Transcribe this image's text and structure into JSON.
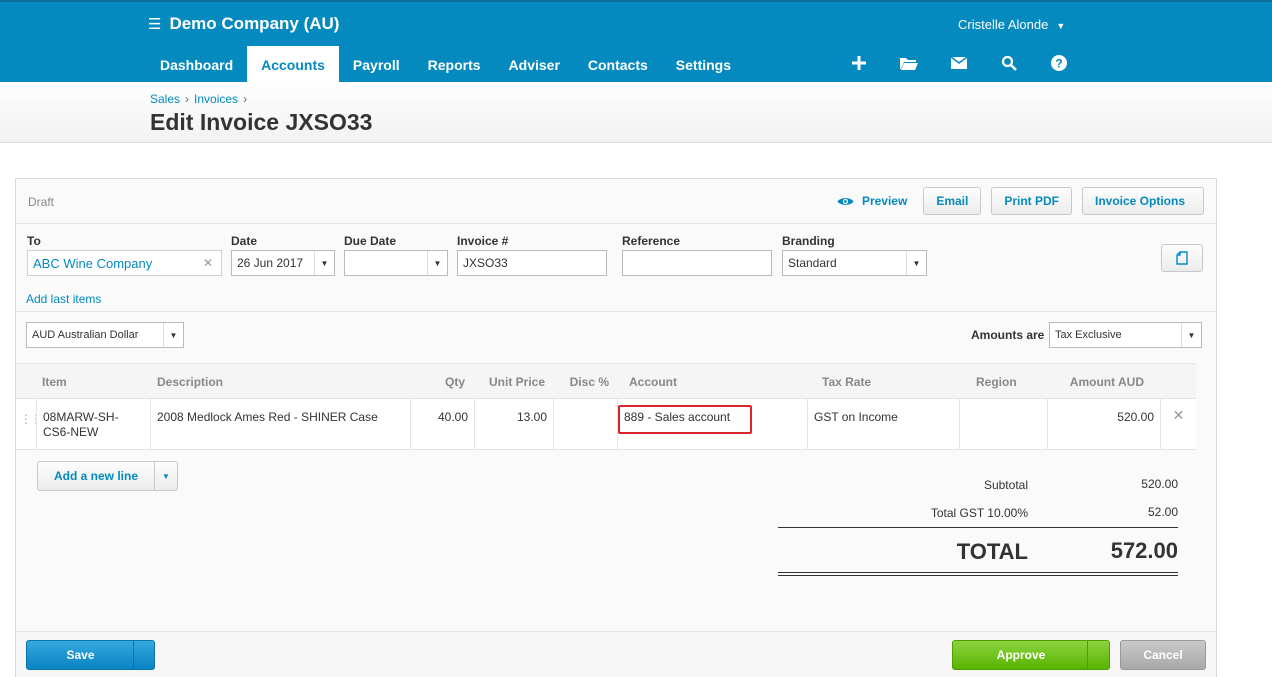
{
  "header": {
    "org_name": "Demo Company (AU)",
    "user_name": "Cristelle Alonde",
    "nav": [
      "Dashboard",
      "Accounts",
      "Payroll",
      "Reports",
      "Adviser",
      "Contacts",
      "Settings"
    ],
    "active_nav": "Accounts",
    "icons": [
      "plus-icon",
      "folder-open-icon",
      "envelope-icon",
      "search-icon",
      "help-icon"
    ]
  },
  "breadcrumb": {
    "sales": "Sales",
    "invoices": "Invoices",
    "sep": "›"
  },
  "page_title": "Edit Invoice JXSO33",
  "status": "Draft",
  "actions": {
    "preview": "Preview",
    "email": "Email",
    "print_pdf": "Print PDF",
    "invoice_options": "Invoice Options"
  },
  "form": {
    "to_label": "To",
    "to_value": "ABC Wine Company",
    "date_label": "Date",
    "date_value": "26 Jun 2017",
    "due_date_label": "Due Date",
    "due_date_value": "",
    "invoice_no_label": "Invoice #",
    "invoice_no_value": "JXSO33",
    "reference_label": "Reference",
    "reference_value": "",
    "branding_label": "Branding",
    "branding_value": "Standard",
    "add_last_items": "Add last items",
    "currency": "AUD Australian Dollar",
    "amounts_are_label": "Amounts are",
    "amounts_are_value": "Tax Exclusive"
  },
  "table": {
    "headers": {
      "item": "Item",
      "description": "Description",
      "qty": "Qty",
      "unit_price": "Unit Price",
      "disc": "Disc %",
      "account": "Account",
      "tax_rate": "Tax Rate",
      "region": "Region",
      "amount": "Amount AUD"
    },
    "rows": [
      {
        "item": "08MARW-SH-CS6-NEW",
        "description": "2008 Medlock Ames Red - SHINER Case",
        "qty": "40.00",
        "unit_price": "13.00",
        "disc": "",
        "account": "889 - Sales account",
        "tax_rate": "GST on Income",
        "region": "",
        "amount": "520.00"
      }
    ]
  },
  "add_line": "Add a new line",
  "totals": {
    "subtotal_label": "Subtotal",
    "subtotal": "520.00",
    "gst_label": "Total GST 10.00%",
    "gst": "52.00",
    "total_label": "TOTAL",
    "total": "572.00"
  },
  "footer": {
    "save": "Save",
    "approve": "Approve",
    "cancel": "Cancel"
  }
}
